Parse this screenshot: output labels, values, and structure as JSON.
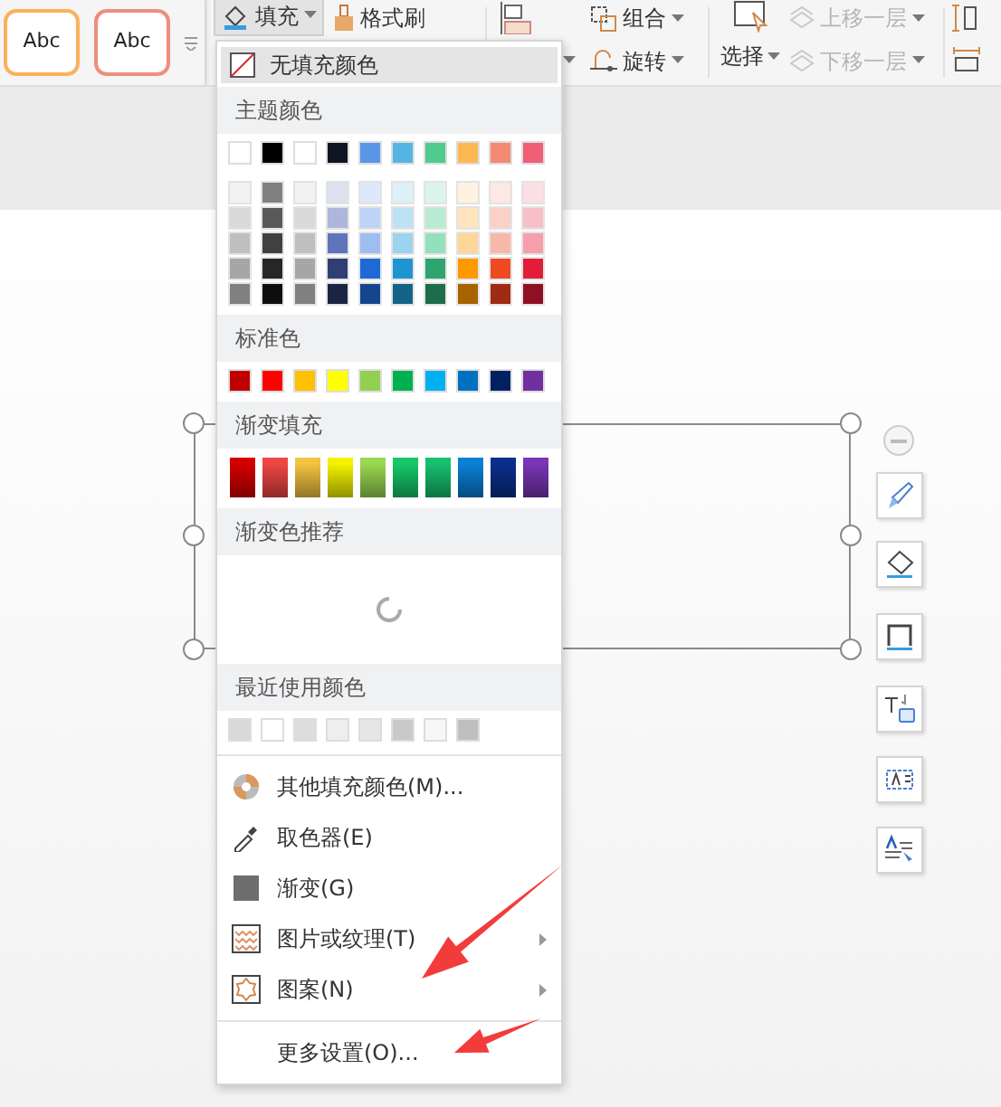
{
  "ribbon": {
    "presets": [
      {
        "label": "Abc",
        "color": "#f9b25c"
      },
      {
        "label": "Abc",
        "color": "#ee8e7c"
      }
    ],
    "fill": {
      "label": "填充",
      "expanded": true
    },
    "format_painter": {
      "label": "格式刷"
    },
    "group": {
      "label": "组合"
    },
    "rotate": {
      "label": "旋转"
    },
    "select": {
      "label": "选择"
    },
    "bring_forward": {
      "label": "上移一层",
      "disabled": true
    },
    "send_backward": {
      "label": "下移一层",
      "disabled": true
    }
  },
  "fill_menu": {
    "no_fill": {
      "label": "无填充颜色",
      "selected": true
    },
    "theme_colors": {
      "title": "主题颜色",
      "base": [
        {
          "color": "#ffffff"
        },
        {
          "color": "#000000"
        },
        {
          "color": "#ffffff"
        },
        {
          "color": "#0f1423"
        },
        {
          "color": "#5b96e6"
        },
        {
          "color": "#55b6e6"
        },
        {
          "color": "#4fcb8e"
        },
        {
          "color": "#feb851"
        },
        {
          "color": "#f38a71"
        },
        {
          "color": "#ef5f75"
        }
      ],
      "shades": [
        [
          {
            "color": "#f2f2f2"
          },
          {
            "color": "#d9d9d9"
          },
          {
            "color": "#bfbfbf"
          },
          {
            "color": "#a6a6a6"
          },
          {
            "color": "#808080"
          }
        ],
        [
          {
            "color": "#808080"
          },
          {
            "color": "#595959"
          },
          {
            "color": "#404040"
          },
          {
            "color": "#262626"
          },
          {
            "color": "#0d0d0d"
          }
        ],
        [
          {
            "color": "#f2f2f2"
          },
          {
            "color": "#d9d9d9"
          },
          {
            "color": "#bfbfbf"
          },
          {
            "color": "#a6a6a6"
          },
          {
            "color": "#808080"
          }
        ],
        [
          {
            "color": "#dde0ef"
          },
          {
            "color": "#aeb6dc"
          },
          {
            "color": "#5f74bb"
          },
          {
            "color": "#2f3f74"
          },
          {
            "color": "#1c2444"
          }
        ],
        [
          {
            "color": "#dde8f9"
          },
          {
            "color": "#bed3f5"
          },
          {
            "color": "#a0bdf0"
          },
          {
            "color": "#1f69d6"
          },
          {
            "color": "#14468f"
          }
        ],
        [
          {
            "color": "#def0fa"
          },
          {
            "color": "#bde2f5"
          },
          {
            "color": "#9cd3ee"
          },
          {
            "color": "#1e95d2"
          },
          {
            "color": "#146389"
          }
        ],
        [
          {
            "color": "#dcf5ea"
          },
          {
            "color": "#b9ecd3"
          },
          {
            "color": "#95e0bc"
          },
          {
            "color": "#2ea46f"
          },
          {
            "color": "#1e6d4a"
          }
        ],
        [
          {
            "color": "#fff2e0"
          },
          {
            "color": "#ffe4be"
          },
          {
            "color": "#ffd699"
          },
          {
            "color": "#ff9900"
          },
          {
            "color": "#a66300"
          }
        ],
        [
          {
            "color": "#fde8e3"
          },
          {
            "color": "#fbd0c6"
          },
          {
            "color": "#f8b8a9"
          },
          {
            "color": "#ee4b22"
          },
          {
            "color": "#9e2b12"
          }
        ],
        [
          {
            "color": "#fcdfe4"
          },
          {
            "color": "#f9bfc9"
          },
          {
            "color": "#f59fad"
          },
          {
            "color": "#e21d3a"
          },
          {
            "color": "#8f1024"
          }
        ]
      ]
    },
    "standard_colors": {
      "title": "标准色",
      "colors": [
        {
          "color": "#c00000"
        },
        {
          "color": "#ff0000"
        },
        {
          "color": "#ffc000"
        },
        {
          "color": "#ffff00"
        },
        {
          "color": "#92d050"
        },
        {
          "color": "#00b050"
        },
        {
          "color": "#00b0f0"
        },
        {
          "color": "#0070c0"
        },
        {
          "color": "#002060"
        },
        {
          "color": "#7030a0"
        }
      ]
    },
    "gradient_fill": {
      "title": "渐变填充",
      "gradients": [
        {
          "color": "#d40000"
        },
        {
          "color": "#f04545"
        },
        {
          "color": "#f3c440"
        },
        {
          "color": "#f3f300"
        },
        {
          "color": "#9ad850"
        },
        {
          "color": "#16c76a"
        },
        {
          "color": "#16c070"
        },
        {
          "color": "#0a7fd6"
        },
        {
          "color": "#0a2f8a"
        },
        {
          "color": "#7a35b5"
        }
      ]
    },
    "gradient_presets": {
      "title": "渐变色推荐",
      "loading": true
    },
    "recent_colors": {
      "title": "最近使用颜色",
      "colors": [
        {
          "color": "#d9d9d9"
        },
        {
          "color": "#ffffff"
        },
        {
          "color": "#dddddd"
        },
        {
          "color": "#eeeeee"
        },
        {
          "color": "#e6e6e6"
        },
        {
          "color": "#c9c9c9"
        },
        {
          "color": "#f7f7f7"
        },
        {
          "color": "#bfbfbf"
        }
      ]
    },
    "items": [
      {
        "label": "其他填充颜色(M)...",
        "submenu": false
      },
      {
        "label": "取色器(E)",
        "submenu": false
      },
      {
        "label": "渐变(G)",
        "submenu": false
      },
      {
        "label": "图片或纹理(T)",
        "submenu": true
      },
      {
        "label": "图案(N)",
        "submenu": true
      }
    ],
    "more": {
      "label": "更多设置(O)..."
    }
  }
}
